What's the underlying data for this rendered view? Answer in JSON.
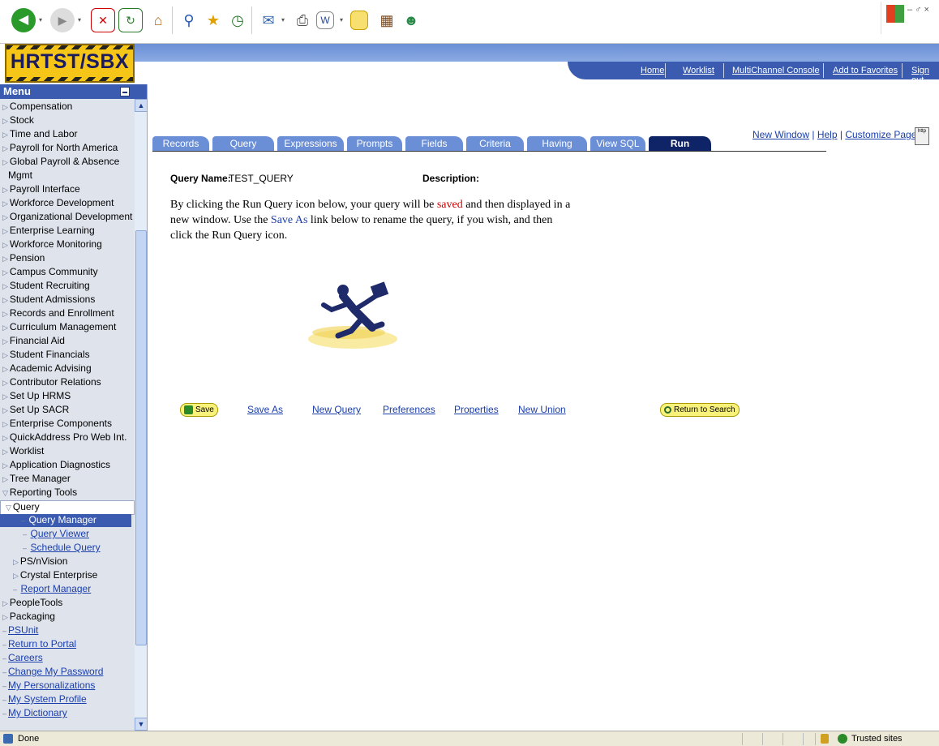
{
  "browser": {
    "toolbar_icons": [
      "back-icon",
      "forward-icon",
      "stop-icon",
      "refresh-icon",
      "home-icon",
      "search-icon",
      "favorites-icon",
      "history-icon",
      "mail-icon",
      "print-icon",
      "word-icon",
      "notes-icon",
      "research-icon",
      "messenger-icon"
    ],
    "window_controls": "– ♂ ×"
  },
  "brand": {
    "label": "HRTST/SBX"
  },
  "header": {
    "links": [
      "Home",
      "Worklist",
      "MultiChannel Console",
      "Add to Favorites",
      "Sign out"
    ]
  },
  "menu": {
    "title": "Menu",
    "items": [
      {
        "label": "Compensation",
        "kind": "node"
      },
      {
        "label": "Stock",
        "kind": "node"
      },
      {
        "label": "Time and Labor",
        "kind": "node"
      },
      {
        "label": "Payroll for North America",
        "kind": "node"
      },
      {
        "label": "Global Payroll & Absence",
        "kind": "node"
      },
      {
        "label": "Mgmt",
        "kind": "cont"
      },
      {
        "label": "Payroll Interface",
        "kind": "node"
      },
      {
        "label": "Workforce Development",
        "kind": "node"
      },
      {
        "label": "Organizational Development",
        "kind": "node"
      },
      {
        "label": "Enterprise Learning",
        "kind": "node"
      },
      {
        "label": "Workforce Monitoring",
        "kind": "node"
      },
      {
        "label": "Pension",
        "kind": "node"
      },
      {
        "label": "Campus Community",
        "kind": "node"
      },
      {
        "label": "Student Recruiting",
        "kind": "node"
      },
      {
        "label": "Student Admissions",
        "kind": "node"
      },
      {
        "label": "Records and Enrollment",
        "kind": "node"
      },
      {
        "label": "Curriculum Management",
        "kind": "node"
      },
      {
        "label": "Financial Aid",
        "kind": "node"
      },
      {
        "label": "Student Financials",
        "kind": "node"
      },
      {
        "label": "Academic Advising",
        "kind": "node"
      },
      {
        "label": "Contributor Relations",
        "kind": "node"
      },
      {
        "label": "Set Up HRMS",
        "kind": "node"
      },
      {
        "label": "Set Up SACR",
        "kind": "node"
      },
      {
        "label": "Enterprise Components",
        "kind": "node"
      },
      {
        "label": "QuickAddress Pro Web Int.",
        "kind": "node"
      },
      {
        "label": "Worklist",
        "kind": "node"
      },
      {
        "label": "Application Diagnostics",
        "kind": "node"
      },
      {
        "label": "Tree Manager",
        "kind": "node"
      },
      {
        "label": "Reporting Tools",
        "kind": "open"
      },
      {
        "label": "Query",
        "kind": "subopen"
      },
      {
        "label": "Query Manager",
        "kind": "sel"
      },
      {
        "label": "Query Viewer",
        "kind": "sublink"
      },
      {
        "label": "Schedule Query",
        "kind": "sublink"
      },
      {
        "label": "PS/nVision",
        "kind": "subnode"
      },
      {
        "label": "Crystal Enterprise",
        "kind": "subnode"
      },
      {
        "label": "Report Manager",
        "kind": "sublink1"
      },
      {
        "label": "PeopleTools",
        "kind": "node"
      },
      {
        "label": "Packaging",
        "kind": "node"
      },
      {
        "label": "PSUnit",
        "kind": "link"
      },
      {
        "label": "Return to Portal",
        "kind": "link"
      },
      {
        "label": "Careers",
        "kind": "link"
      },
      {
        "label": "Change My Password",
        "kind": "link"
      },
      {
        "label": "My Personalizations",
        "kind": "link"
      },
      {
        "label": "My System Profile",
        "kind": "link"
      },
      {
        "label": "My Dictionary",
        "kind": "link"
      }
    ]
  },
  "page_links": {
    "new_window": "New Window",
    "help": "Help",
    "customize": "Customize Page",
    "sep": "|",
    "http_icon": "http"
  },
  "tabs": [
    "Records",
    "Query",
    "Expressions",
    "Prompts",
    "Fields",
    "Criteria",
    "Having",
    "View SQL",
    "Run"
  ],
  "query": {
    "name_label": "Query Name:",
    "name_value": "TEST_QUERY",
    "description_label": "Description:",
    "text_part1": "By clicking the Run Query icon below, your query will be ",
    "text_saved": "saved",
    "text_part2": " and then displayed in a new window. Use the ",
    "text_saveas": "Save As",
    "text_part3": " link below to rename the query, if you wish, and then click the Run Query icon."
  },
  "actions": {
    "save": "Save",
    "save_as": "Save As",
    "new_query": "New Query",
    "preferences": "Preferences",
    "properties": "Properties",
    "new_union": "New Union",
    "return_to_search": "Return to Search"
  },
  "status": {
    "left": "Done",
    "zone": "Trusted sites"
  },
  "colors": {
    "accent": "#3a5bb0",
    "tab": "#6b8fd6",
    "tab_active": "#0f2466",
    "button": "#f9f27a",
    "link": "#1a3eaa",
    "brand": "#f5c518"
  }
}
